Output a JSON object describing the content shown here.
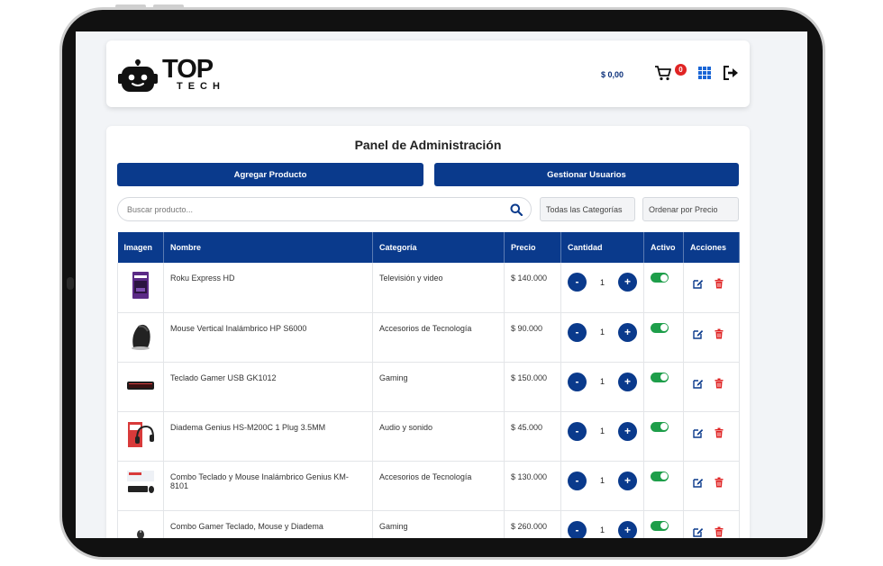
{
  "header": {
    "brand_top": "TOP",
    "brand_tech": "TECH",
    "balance": "$ 0,00",
    "cart_count": "0",
    "icons": [
      "robot-logo",
      "cart-icon",
      "grid-menu-icon",
      "logout-icon"
    ]
  },
  "panel": {
    "title": "Panel de Administración",
    "add_product_label": "Agregar Producto",
    "manage_users_label": "Gestionar Usuarios",
    "search_placeholder": "Buscar producto...",
    "category_filter": "Todas las Categorías",
    "sort_filter": "Ordenar por Precio"
  },
  "table": {
    "columns": [
      "Imagen",
      "Nombre",
      "Categoría",
      "Precio",
      "Cantidad",
      "Activo",
      "Acciones"
    ],
    "rows": [
      {
        "name": "Roku Express HD",
        "category": "Televisión y video",
        "price": "$ 140.000",
        "qty": "1",
        "active": true
      },
      {
        "name": "Mouse Vertical Inalámbrico HP S6000",
        "category": "Accesorios de Tecnología",
        "price": "$ 90.000",
        "qty": "1",
        "active": true
      },
      {
        "name": "Teclado Gamer USB GK1012",
        "category": "Gaming",
        "price": "$ 150.000",
        "qty": "1",
        "active": true
      },
      {
        "name": "Diadema Genius HS-M200C 1 Plug 3.5MM",
        "category": "Audio y sonido",
        "price": "$ 45.000",
        "qty": "1",
        "active": true
      },
      {
        "name": "Combo Teclado y Mouse Inalámbrico Genius KM-8101",
        "category": "Accesorios de Tecnología",
        "price": "$ 130.000",
        "qty": "1",
        "active": true
      },
      {
        "name": "Combo Gamer Teclado, Mouse y Diadema",
        "category": "Gaming",
        "price": "$ 260.000",
        "qty": "1",
        "active": true
      }
    ]
  },
  "colors": {
    "primary": "#0a3a8c",
    "toggle_on": "#1e9e4a",
    "delete": "#e02424",
    "badge": "#e02424"
  }
}
